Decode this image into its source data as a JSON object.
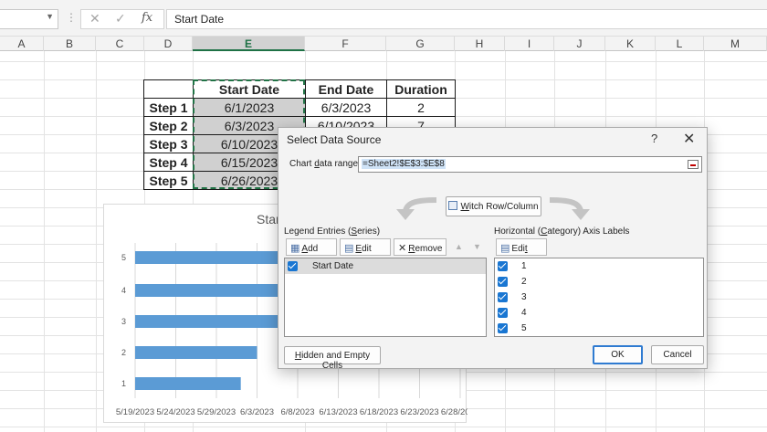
{
  "formula_bar": {
    "name_box": "",
    "cancel_icon": "cancel-x-icon",
    "enter_icon": "check-icon",
    "fx_label": "fx",
    "content": "Start Date"
  },
  "columns": [
    "A",
    "B",
    "C",
    "D",
    "E",
    "F",
    "G",
    "H",
    "I",
    "J",
    "K",
    "L",
    "M"
  ],
  "selected_column": "E",
  "table": {
    "headers": [
      "",
      "Start Date",
      "End Date",
      "Duration"
    ],
    "rows": [
      {
        "step": "Step 1",
        "start": "6/1/2023",
        "end": "6/3/2023",
        "duration": "2"
      },
      {
        "step": "Step 2",
        "start": "6/3/2023",
        "end": "6/10/2023",
        "duration": "7"
      },
      {
        "step": "Step 3",
        "start": "6/10/2023",
        "end": "",
        "duration": ""
      },
      {
        "step": "Step 4",
        "start": "6/15/2023",
        "end": "",
        "duration": ""
      },
      {
        "step": "Step 5",
        "start": "6/26/2023",
        "end": "",
        "duration": ""
      }
    ]
  },
  "chart": {
    "title_visible": "Star"
  },
  "chart_data": {
    "type": "bar",
    "orientation": "horizontal",
    "title": "Star",
    "categories": [
      "1",
      "2",
      "3",
      "4",
      "5"
    ],
    "series": [
      {
        "values": [
          "2023-06-01",
          "2023-06-03",
          "2023-06-10",
          "2023-06-15",
          "2023-06-26"
        ]
      }
    ],
    "x_tick_labels": [
      "5/19/2023",
      "5/24/2023",
      "5/29/2023",
      "6/3/2023",
      "6/8/2023",
      "6/13/2023",
      "6/18/2023",
      "6/23/2023",
      "6/28/2023"
    ],
    "xlim": [
      "2023-05-19",
      "2023-06-28"
    ],
    "grid": true,
    "bar_color": "#5b9bd5"
  },
  "dialog": {
    "title": "Select Data Source",
    "help": "?",
    "close_icon": "close-icon",
    "range_label_pre": "Chart ",
    "range_label_u": "d",
    "range_label_post": "ata range:",
    "range_value": "=Sheet2!$E$3:$E$8",
    "switch_pre": "",
    "switch_u": "W",
    "switch_post": "itch Row/Column",
    "legend_label_pre": "Legend Entries (",
    "legend_label_u": "S",
    "legend_label_post": "eries)",
    "axis_label_pre": "Horizontal (",
    "axis_label_u": "C",
    "axis_label_post": "ategory) Axis Labels",
    "add_label_u": "A",
    "add_label_post": "dd",
    "edit_label_u": "E",
    "edit_label_post": "dit",
    "remove_label_u": "R",
    "remove_label_post": "emove",
    "axis_edit_label_pre": "Edi",
    "axis_edit_label_u": "t",
    "series": [
      {
        "name": "Start Date",
        "checked": true
      }
    ],
    "axis_labels": [
      "1",
      "2",
      "3",
      "4",
      "5"
    ],
    "hidden_u": "H",
    "hidden_post": "idden and Empty Cells",
    "ok_label": "OK",
    "cancel_label": "Cancel"
  }
}
